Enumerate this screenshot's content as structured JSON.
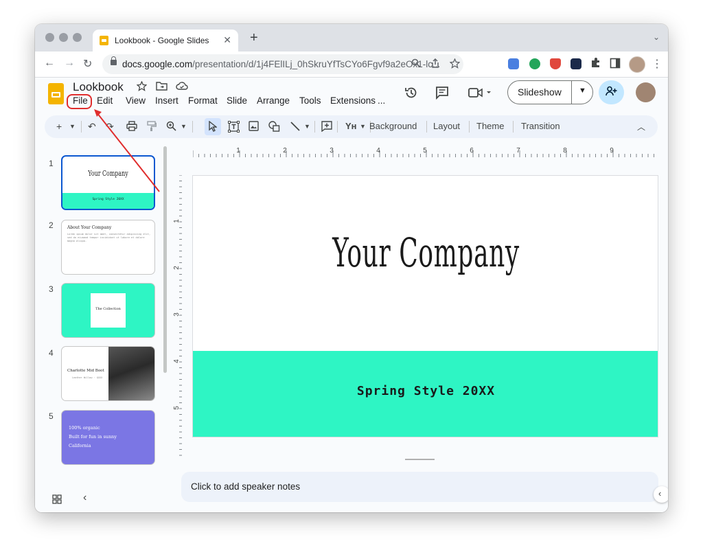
{
  "browser": {
    "tab_title": "Lookbook - Google Slides",
    "tab_close": "✕",
    "new_tab": "+",
    "tab_menu": "⌄",
    "back": "←",
    "forward": "→",
    "reload": "↻",
    "url_host": "docs.google.com",
    "url_path": "/presentation/d/1j4FElILj_0hSkruYfTsCYo6Fgvf9a2eOx1-lc...",
    "kebab": "⋮"
  },
  "app": {
    "doc_title": "Lookbook",
    "menu": [
      "File",
      "Edit",
      "View",
      "Insert",
      "Format",
      "Slide",
      "Arrange",
      "Tools",
      "Extensions",
      "..."
    ],
    "highlighted_menu": "File",
    "slideshow_label": "Slideshow",
    "accent_color": "#0b57d0",
    "highlight_color": "#e02d2d"
  },
  "toolbar": {
    "items": [
      "Background",
      "Layout",
      "Theme",
      "Transition"
    ]
  },
  "ruler": {
    "horizontal_labels": [
      "1",
      "2",
      "3",
      "4",
      "5",
      "6",
      "7",
      "8",
      "9"
    ],
    "vertical_labels": [
      "1",
      "2",
      "3",
      "4",
      "5"
    ]
  },
  "filmstrip": {
    "slides": [
      {
        "number": "1",
        "title": "Your Company",
        "subtitle": "Spring Style 20XX"
      },
      {
        "number": "2",
        "title": "About Your Company",
        "body": "Lorem ipsum dolor sit amet, consectetur adipiscing elit, sed do eiusmod tempor incididunt ut labore et dolore magna aliqua."
      },
      {
        "number": "3",
        "title": "The Collection"
      },
      {
        "number": "4",
        "title": "Charlotte Mid Boot",
        "subtitle": "Leather Willow · $XXX"
      },
      {
        "number": "5",
        "lines": [
          "100% organic",
          "Built for fun in sunny",
          "California"
        ]
      }
    ]
  },
  "slide": {
    "title": "Your Company",
    "subtitle": "Spring Style 20XX",
    "band_color": "#2ef5c4"
  },
  "notes": {
    "placeholder": "Click to add speaker notes"
  }
}
